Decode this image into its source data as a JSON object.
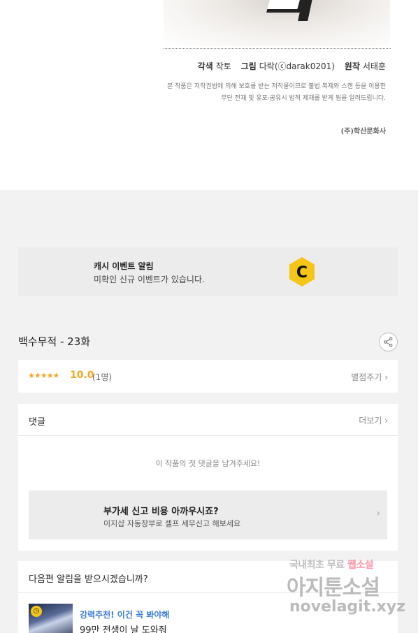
{
  "credits": {
    "adaptation_label": "각색",
    "adaptation_name": "작토",
    "art_label": "그림",
    "art_name": "다락(ⓒdarak0201)",
    "original_label": "원작",
    "original_name": "서태훈",
    "notice_line1": "본 작품은 저작권법에 의해 보호를 받는 저작물이므로 불법 복제와 스캔 등을 이용한",
    "notice_line2": "무단 전재 및 유포·공유시 법적 제재를 받게 됨을 알려드립니다.",
    "publisher": "(주)학산문화사"
  },
  "cash_event": {
    "title": "캐시 이벤트 알림",
    "subtitle": "미확인 신규 이벤트가 있습니다.",
    "logo_letter": "C",
    "logo_color": "#f5c518"
  },
  "episode": {
    "title": "백수무적 - 23화",
    "share_icon": "share-icon"
  },
  "rating": {
    "stars": "★★★★★",
    "score": "10.0",
    "count": "(1명)",
    "action_label": "별점주기",
    "star_color": "#f5a623"
  },
  "comments": {
    "title": "댓글",
    "more_label": "더보기",
    "empty_message": "이 작품의 첫 댓글을 남겨주세요!",
    "ad_title": "부가세 신고 비용 아까우시죠?",
    "ad_subtitle": "이지샵 자동장부로 셀프 세무신고 해보세요"
  },
  "next_alert": {
    "title": "다음편 알림을 받으시겠습니까?",
    "rec_tag": "강력추천! 이건 꼭 봐야해",
    "rec_title": "99만 전생이 날 도와줘",
    "tag_color": "#3d7de0"
  },
  "watermark": {
    "line1_a": "국내최초 무료",
    "line1_b": "웹소설",
    "line2": "아지툰소설",
    "line3": "novelagit.xyz"
  }
}
